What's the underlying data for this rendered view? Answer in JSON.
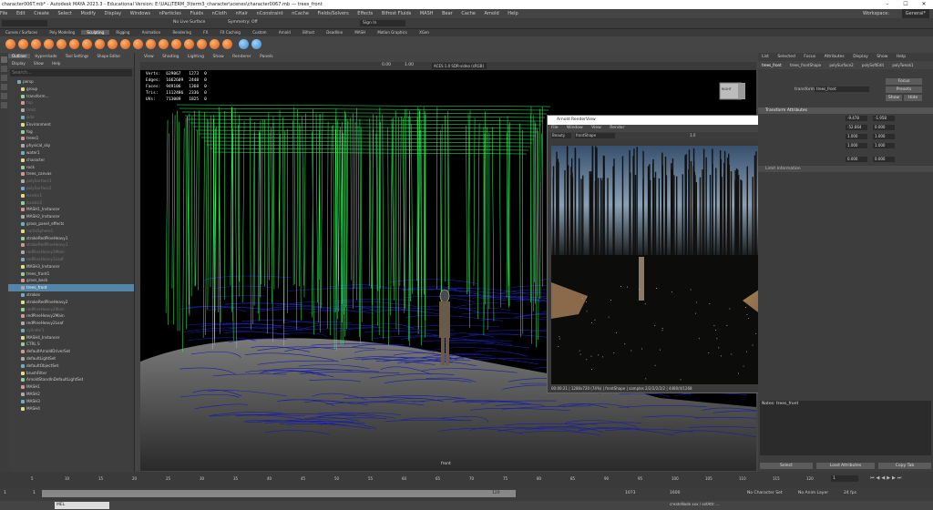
{
  "titlebar": {
    "title": "character006T.mb* - Autodesk MAYA 2023.3 - Educational Version: E:\\UAL\\TERM_3\\term3_character\\scenes\\character0067.mb  ---  trees_front",
    "workspace_label": "Workspace:",
    "workspace_value": "General*"
  },
  "menubar": [
    "File",
    "Edit",
    "Create",
    "Select",
    "Modify",
    "Display",
    "Windows",
    "nParticles",
    "Fluids",
    "nCloth",
    "nHair",
    "nConstraint",
    "nCache",
    "Fields/Solvers",
    "Effects",
    "Bifrost Fluids",
    "MASH",
    "Bear",
    "Cache",
    "Arnold",
    "Help"
  ],
  "statusline": {
    "no_live_surface": "No Live Surface",
    "symmetry": "Symmetry: Off",
    "signin": "Sign In"
  },
  "shelf_tabs": [
    "Curves / Surfaces",
    "Poly Modeling",
    "Sculpting",
    "Rigging",
    "Animation",
    "Rendering",
    "FX",
    "FX Caching",
    "Custom",
    "Arnold",
    "Bifrost",
    "Deadline",
    "MASH",
    "Motion Graphics",
    "XGen"
  ],
  "shelf_active": "Sculpting",
  "outliner": {
    "tabs": [
      "Outliner",
      "Hypershade",
      "Tool Settings",
      "Shape Editor"
    ],
    "menu": [
      "Display",
      "Show",
      "Help"
    ],
    "search_placeholder": "Search...",
    "items": [
      {
        "label": "persp",
        "dim": false
      },
      {
        "label": "group",
        "dim": false
      },
      {
        "label": "transform...",
        "dim": false
      },
      {
        "label": "top",
        "dim": true
      },
      {
        "label": "front",
        "dim": true
      },
      {
        "label": "side",
        "dim": true
      },
      {
        "label": "Environment",
        "dim": false
      },
      {
        "label": "fog",
        "dim": false
      },
      {
        "label": "trees1",
        "dim": false
      },
      {
        "label": "physical_sky",
        "dim": false
      },
      {
        "label": "water1",
        "dim": false
      },
      {
        "label": "character",
        "dim": false
      },
      {
        "label": "rock",
        "dim": false
      },
      {
        "label": "trees_canvas",
        "dim": false
      },
      {
        "label": "polySurface1",
        "dim": true
      },
      {
        "label": "polySurface2",
        "dim": true
      },
      {
        "label": "locator1",
        "dim": true
      },
      {
        "label": "locator2",
        "dim": true
      },
      {
        "label": "MASH1_Instancer",
        "dim": false
      },
      {
        "label": "MASH2_Instancer",
        "dim": false
      },
      {
        "label": "grass_panel_effects",
        "dim": false
      },
      {
        "label": "nurbsSphere1",
        "dim": true
      },
      {
        "label": "strokeRedPineHeavy1",
        "dim": false
      },
      {
        "label": "strokeRedPineHeavy1",
        "dim": true
      },
      {
        "label": "redPineHeavy1Main",
        "dim": true
      },
      {
        "label": "redPineHeavy1Leaf",
        "dim": true
      },
      {
        "label": "MASH3_Instancer",
        "dim": false
      },
      {
        "label": "trees_front1",
        "dim": false
      },
      {
        "label": "grass_back",
        "dim": false
      },
      {
        "label": "trees_front",
        "dim": false,
        "selected": true
      },
      {
        "label": "strokes",
        "dim": false
      },
      {
        "label": "strokeRedPineHeavy2",
        "dim": false
      },
      {
        "label": "redPineHeavy2Main",
        "dim": true
      },
      {
        "label": "redPineHeavy2Main",
        "dim": false
      },
      {
        "label": "redPineHeavy2Leaf",
        "dim": false
      },
      {
        "label": "cylinder1",
        "dim": true
      },
      {
        "label": "MASH4_Instancer",
        "dim": false
      },
      {
        "label": "CTRL S",
        "dim": false
      },
      {
        "label": "defaultArnoldDriverSet",
        "dim": false
      },
      {
        "label": "defaultLightSet",
        "dim": false
      },
      {
        "label": "defaultObjectSet",
        "dim": false
      },
      {
        "label": "brushFilter",
        "dim": false
      },
      {
        "label": "ArnoldStandInDefaultLightSet",
        "dim": false
      },
      {
        "label": "MASH1",
        "dim": false
      },
      {
        "label": "MASH2",
        "dim": false
      },
      {
        "label": "MASH3",
        "dim": false
      },
      {
        "label": "MASH4",
        "dim": false
      }
    ]
  },
  "viewport": {
    "menu": [
      "View",
      "Shading",
      "Lighting",
      "Show",
      "Renderer",
      "Panels"
    ],
    "exposure": "0.00",
    "gamma": "1.00",
    "colorspace": "ACES 1.0 SDR-video (sRGB)",
    "camera": "front",
    "viewcube": "RIGHT",
    "hud": [
      {
        "label": "Verts:",
        "a": "629067",
        "b": "1273",
        "c": "0"
      },
      {
        "label": "Edges:",
        "a": "1662609",
        "b": "2448",
        "c": "0"
      },
      {
        "label": "Faces:",
        "a": "949106",
        "b": "1368",
        "c": "0"
      },
      {
        "label": "Tris:",
        "a": "1112486",
        "b": "2336",
        "c": "0"
      },
      {
        "label": "UVs:",
        "a": "713089",
        "b": "1825",
        "c": "0"
      }
    ]
  },
  "renderview": {
    "title": "Arnold RenderView",
    "menu": [
      "File",
      "Window",
      "View",
      "Render"
    ],
    "camera": "Beauty",
    "camshape": "frontShape",
    "zoom": "1.0",
    "status": "00:00:21 | 1280x720 (74%) | frontShape | samples 2/2/2/2/2/2 | 4480/4/1268"
  },
  "channelbox": {
    "menu": [
      "List",
      "Selected",
      "Focus",
      "Attributes",
      "Display",
      "Show",
      "Help"
    ],
    "node_tabs": [
      "trees_front",
      "trees_frontShape",
      "polySurface2",
      "polySoftEdit",
      "polyTweak1"
    ],
    "transform_label": "transform:",
    "transform_value": "trees_front",
    "focus_btn": "Focus",
    "presets_btn": "Presets",
    "show_btn": "Show",
    "hide_btn": "Hide",
    "section": "Transform Attributes",
    "values": [
      "-9.478",
      "-1.958",
      "-52.664",
      "0.000",
      "1.000",
      "1.000",
      "1.000",
      "1.000",
      "0.000",
      "0.000"
    ],
    "limit": "Limit Information",
    "notes": "Notes: trees_front",
    "select": "Select",
    "load_attrs": "Load Attributes",
    "copy_tab": "Copy Tab"
  },
  "timeslider": {
    "ticks": [
      "5",
      "10",
      "15",
      "20",
      "25",
      "30",
      "35",
      "40",
      "45",
      "50",
      "55",
      "60",
      "65",
      "70",
      "75",
      "80",
      "85",
      "90",
      "95",
      "100",
      "105",
      "110",
      "115",
      "120"
    ],
    "current": "1"
  },
  "rangebar": {
    "start": "1",
    "inner_start": "1",
    "inner_end": "120",
    "end": "1073",
    "end2": "1600",
    "char_set": "No Character Set",
    "anim_layer": "No Anim Layer",
    "fps": "24 fps"
  },
  "cmdline": {
    "mode": "MEL",
    "output": "createNode xxx / setAttr ..."
  }
}
